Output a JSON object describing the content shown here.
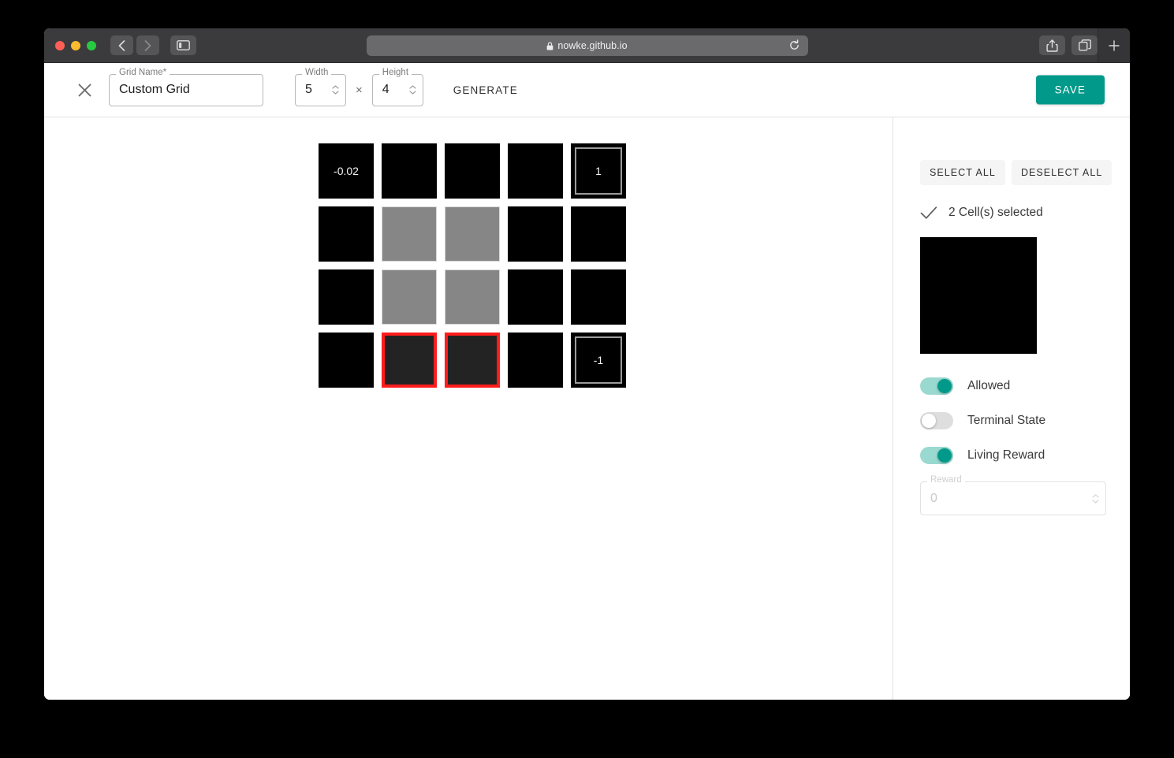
{
  "browser": {
    "url": "nowke.github.io",
    "lock_icon": "lock-icon",
    "reload_icon": "reload-icon",
    "back_icon": "chevron-left-icon",
    "forward_icon": "chevron-right-icon",
    "sidebar_icon": "sidebar-toggle-icon",
    "share_icon": "share-icon",
    "tabs_icon": "show-tabs-icon",
    "new_tab_icon": "plus-icon"
  },
  "header": {
    "close_icon": "close-icon",
    "grid_name": {
      "label": "Grid Name*",
      "value": "Custom Grid"
    },
    "width": {
      "label": "Width",
      "value": "5"
    },
    "height": {
      "label": "Height",
      "value": "4"
    },
    "separator": "×",
    "generate_label": "GENERATE",
    "save_label": "SAVE",
    "save_color": "#00998a"
  },
  "grid": {
    "cols": 5,
    "rows": 4,
    "colors": {
      "normal": "#000000",
      "wall": "#868686",
      "selected_fill": "#232323",
      "selected_border": "#ff1c1c",
      "terminal_border": "#9b9b9b"
    },
    "cells": [
      {
        "type": "normal",
        "value": "-0.02",
        "selected": false
      },
      {
        "type": "normal",
        "value": "",
        "selected": false
      },
      {
        "type": "normal",
        "value": "",
        "selected": false
      },
      {
        "type": "normal",
        "value": "",
        "selected": false
      },
      {
        "type": "terminal",
        "value": "1",
        "selected": false
      },
      {
        "type": "normal",
        "value": "",
        "selected": false
      },
      {
        "type": "wall",
        "value": "",
        "selected": false
      },
      {
        "type": "wall",
        "value": "",
        "selected": false
      },
      {
        "type": "normal",
        "value": "",
        "selected": false
      },
      {
        "type": "normal",
        "value": "",
        "selected": false
      },
      {
        "type": "normal",
        "value": "",
        "selected": false
      },
      {
        "type": "wall",
        "value": "",
        "selected": false
      },
      {
        "type": "wall",
        "value": "",
        "selected": false
      },
      {
        "type": "normal",
        "value": "",
        "selected": false
      },
      {
        "type": "normal",
        "value": "",
        "selected": false
      },
      {
        "type": "normal",
        "value": "",
        "selected": false
      },
      {
        "type": "normal",
        "value": "",
        "selected": true
      },
      {
        "type": "normal",
        "value": "",
        "selected": true
      },
      {
        "type": "normal",
        "value": "",
        "selected": false
      },
      {
        "type": "terminal",
        "value": "-1",
        "selected": false
      }
    ]
  },
  "panel": {
    "select_all_label": "SELECT ALL",
    "deselect_all_label": "DESELECT ALL",
    "check_icon": "check-icon",
    "selected_text": "2 Cell(s) selected",
    "preview_color": "#000000",
    "toggles": [
      {
        "label": "Allowed",
        "state": "on"
      },
      {
        "label": "Terminal State",
        "state": "off"
      },
      {
        "label": "Living Reward",
        "state": "on"
      }
    ],
    "toggle_on_color": "#00998a",
    "reward": {
      "label": "Reward",
      "value": "0"
    }
  }
}
